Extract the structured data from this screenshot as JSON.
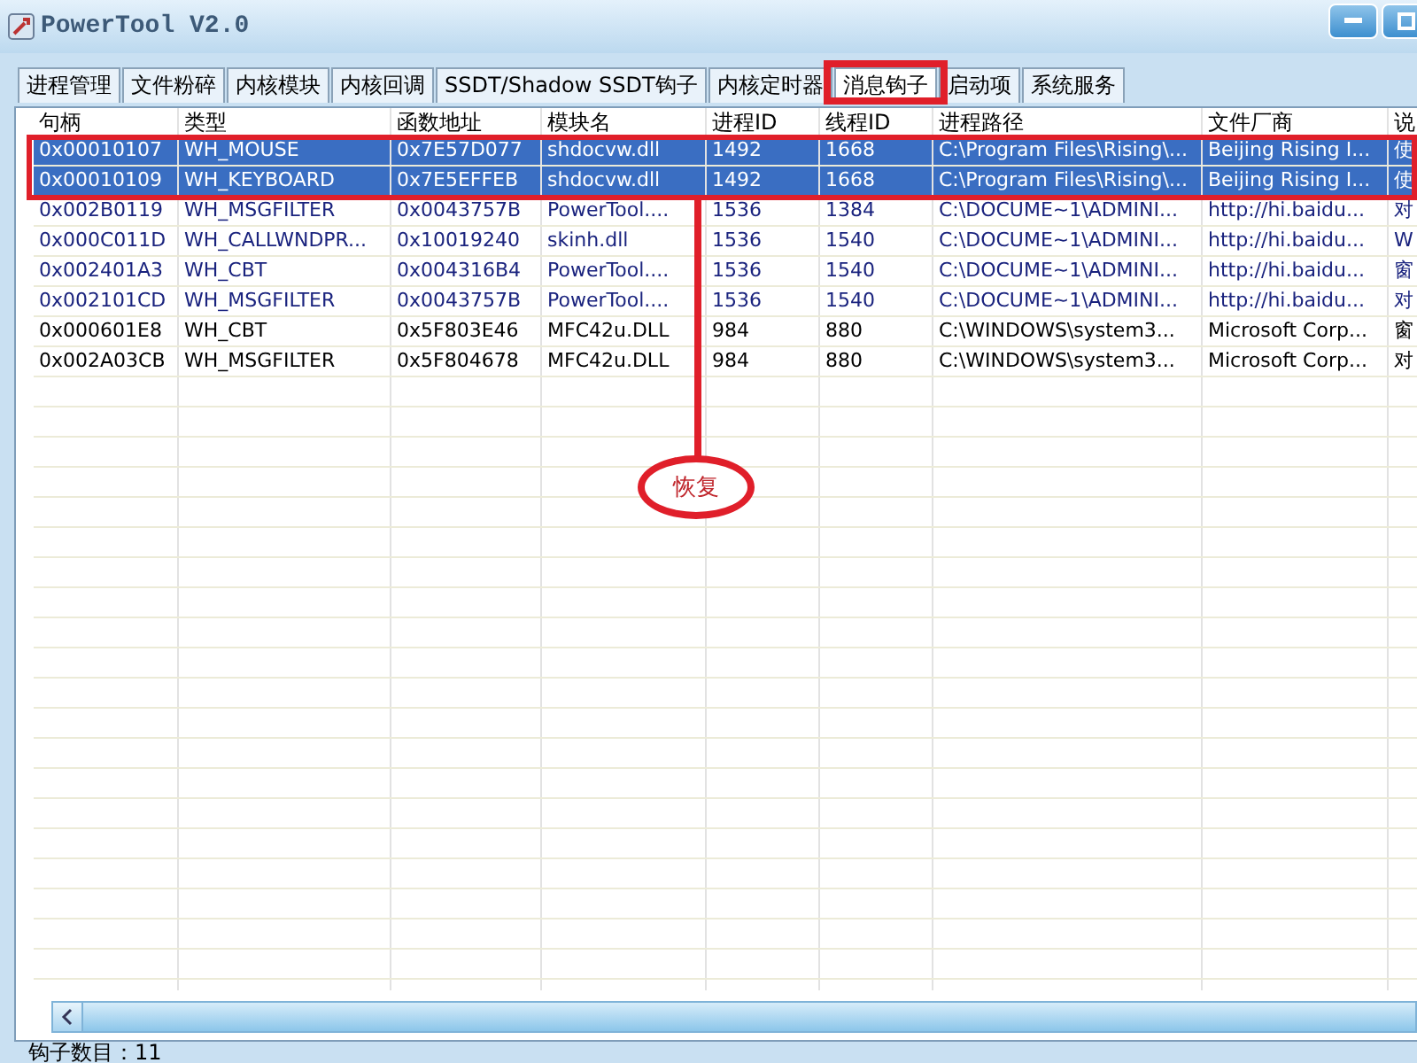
{
  "window": {
    "title": "PowerTool V2.0"
  },
  "tabs": [
    {
      "label": "进程管理",
      "selected": false
    },
    {
      "label": "文件粉碎",
      "selected": false
    },
    {
      "label": "内核模块",
      "selected": false
    },
    {
      "label": "内核回调",
      "selected": false
    },
    {
      "label": "SSDT/Shadow SSDT钩子",
      "selected": false
    },
    {
      "label": "内核定时器",
      "selected": false
    },
    {
      "label": "消息钩子",
      "selected": true
    },
    {
      "label": "启动项",
      "selected": false
    },
    {
      "label": "系统服务",
      "selected": false
    }
  ],
  "table": {
    "columns": [
      "句柄",
      "类型",
      "函数地址",
      "模块名",
      "进程ID",
      "线程ID",
      "进程路径",
      "文件厂商",
      "说"
    ],
    "rows": [
      {
        "selected": true,
        "cells": [
          "0x00010107",
          "WH_MOUSE",
          "0x7E57D077",
          "shdocvw.dll",
          "1492",
          "1668",
          "C:\\Program Files\\Rising\\...",
          "Beijing Rising I...",
          "使"
        ]
      },
      {
        "selected": true,
        "cells": [
          "0x00010109",
          "WH_KEYBOARD",
          "0x7E5EFFEB",
          "shdocvw.dll",
          "1492",
          "1668",
          "C:\\Program Files\\Rising\\...",
          "Beijing Rising I...",
          "使"
        ]
      },
      {
        "selected": false,
        "color": "#1a237e",
        "cells": [
          "0x002B0119",
          "WH_MSGFILTER",
          "0x0043757B",
          "PowerTool....",
          "1536",
          "1384",
          "C:\\DOCUME~1\\ADMINI...",
          "http://hi.baidu...",
          "对"
        ]
      },
      {
        "selected": false,
        "color": "#1a237e",
        "cells": [
          "0x000C011D",
          "WH_CALLWNDPR...",
          "0x10019240",
          "skinh.dll",
          "1536",
          "1540",
          "C:\\DOCUME~1\\ADMINI...",
          "http://hi.baidu...",
          "W"
        ]
      },
      {
        "selected": false,
        "color": "#1a237e",
        "cells": [
          "0x002401A3",
          "WH_CBT",
          "0x004316B4",
          "PowerTool....",
          "1536",
          "1540",
          "C:\\DOCUME~1\\ADMINI...",
          "http://hi.baidu...",
          "窗"
        ]
      },
      {
        "selected": false,
        "color": "#1a237e",
        "cells": [
          "0x002101CD",
          "WH_MSGFILTER",
          "0x0043757B",
          "PowerTool....",
          "1536",
          "1540",
          "C:\\DOCUME~1\\ADMINI...",
          "http://hi.baidu...",
          "对"
        ]
      },
      {
        "selected": false,
        "color": "#000000",
        "cells": [
          "0x000601E8",
          "WH_CBT",
          "0x5F803E46",
          "MFC42u.DLL",
          "984",
          "880",
          "C:\\WINDOWS\\system3...",
          "Microsoft Corp...",
          "窗"
        ]
      },
      {
        "selected": false,
        "color": "#000000",
        "cells": [
          "0x002A03CB",
          "WH_MSGFILTER",
          "0x5F804678",
          "MFC42u.DLL",
          "984",
          "880",
          "C:\\WINDOWS\\system3...",
          "Microsoft Corp...",
          "对"
        ]
      }
    ]
  },
  "annotation": {
    "label": "恢复"
  },
  "status_bar": {
    "text": "钩子数目：11"
  }
}
